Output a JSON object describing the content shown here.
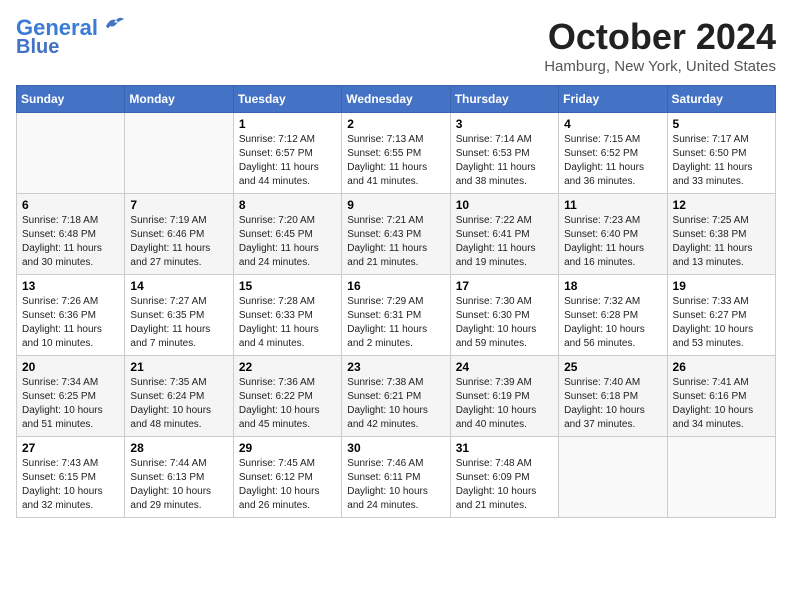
{
  "header": {
    "logo_line1": "General",
    "logo_line2": "Blue",
    "month": "October 2024",
    "location": "Hamburg, New York, United States"
  },
  "weekdays": [
    "Sunday",
    "Monday",
    "Tuesday",
    "Wednesday",
    "Thursday",
    "Friday",
    "Saturday"
  ],
  "weeks": [
    [
      {
        "day": null,
        "info": null
      },
      {
        "day": null,
        "info": null
      },
      {
        "day": "1",
        "info": "Sunrise: 7:12 AM\nSunset: 6:57 PM\nDaylight: 11 hours and 44 minutes."
      },
      {
        "day": "2",
        "info": "Sunrise: 7:13 AM\nSunset: 6:55 PM\nDaylight: 11 hours and 41 minutes."
      },
      {
        "day": "3",
        "info": "Sunrise: 7:14 AM\nSunset: 6:53 PM\nDaylight: 11 hours and 38 minutes."
      },
      {
        "day": "4",
        "info": "Sunrise: 7:15 AM\nSunset: 6:52 PM\nDaylight: 11 hours and 36 minutes."
      },
      {
        "day": "5",
        "info": "Sunrise: 7:17 AM\nSunset: 6:50 PM\nDaylight: 11 hours and 33 minutes."
      }
    ],
    [
      {
        "day": "6",
        "info": "Sunrise: 7:18 AM\nSunset: 6:48 PM\nDaylight: 11 hours and 30 minutes."
      },
      {
        "day": "7",
        "info": "Sunrise: 7:19 AM\nSunset: 6:46 PM\nDaylight: 11 hours and 27 minutes."
      },
      {
        "day": "8",
        "info": "Sunrise: 7:20 AM\nSunset: 6:45 PM\nDaylight: 11 hours and 24 minutes."
      },
      {
        "day": "9",
        "info": "Sunrise: 7:21 AM\nSunset: 6:43 PM\nDaylight: 11 hours and 21 minutes."
      },
      {
        "day": "10",
        "info": "Sunrise: 7:22 AM\nSunset: 6:41 PM\nDaylight: 11 hours and 19 minutes."
      },
      {
        "day": "11",
        "info": "Sunrise: 7:23 AM\nSunset: 6:40 PM\nDaylight: 11 hours and 16 minutes."
      },
      {
        "day": "12",
        "info": "Sunrise: 7:25 AM\nSunset: 6:38 PM\nDaylight: 11 hours and 13 minutes."
      }
    ],
    [
      {
        "day": "13",
        "info": "Sunrise: 7:26 AM\nSunset: 6:36 PM\nDaylight: 11 hours and 10 minutes."
      },
      {
        "day": "14",
        "info": "Sunrise: 7:27 AM\nSunset: 6:35 PM\nDaylight: 11 hours and 7 minutes."
      },
      {
        "day": "15",
        "info": "Sunrise: 7:28 AM\nSunset: 6:33 PM\nDaylight: 11 hours and 4 minutes."
      },
      {
        "day": "16",
        "info": "Sunrise: 7:29 AM\nSunset: 6:31 PM\nDaylight: 11 hours and 2 minutes."
      },
      {
        "day": "17",
        "info": "Sunrise: 7:30 AM\nSunset: 6:30 PM\nDaylight: 10 hours and 59 minutes."
      },
      {
        "day": "18",
        "info": "Sunrise: 7:32 AM\nSunset: 6:28 PM\nDaylight: 10 hours and 56 minutes."
      },
      {
        "day": "19",
        "info": "Sunrise: 7:33 AM\nSunset: 6:27 PM\nDaylight: 10 hours and 53 minutes."
      }
    ],
    [
      {
        "day": "20",
        "info": "Sunrise: 7:34 AM\nSunset: 6:25 PM\nDaylight: 10 hours and 51 minutes."
      },
      {
        "day": "21",
        "info": "Sunrise: 7:35 AM\nSunset: 6:24 PM\nDaylight: 10 hours and 48 minutes."
      },
      {
        "day": "22",
        "info": "Sunrise: 7:36 AM\nSunset: 6:22 PM\nDaylight: 10 hours and 45 minutes."
      },
      {
        "day": "23",
        "info": "Sunrise: 7:38 AM\nSunset: 6:21 PM\nDaylight: 10 hours and 42 minutes."
      },
      {
        "day": "24",
        "info": "Sunrise: 7:39 AM\nSunset: 6:19 PM\nDaylight: 10 hours and 40 minutes."
      },
      {
        "day": "25",
        "info": "Sunrise: 7:40 AM\nSunset: 6:18 PM\nDaylight: 10 hours and 37 minutes."
      },
      {
        "day": "26",
        "info": "Sunrise: 7:41 AM\nSunset: 6:16 PM\nDaylight: 10 hours and 34 minutes."
      }
    ],
    [
      {
        "day": "27",
        "info": "Sunrise: 7:43 AM\nSunset: 6:15 PM\nDaylight: 10 hours and 32 minutes."
      },
      {
        "day": "28",
        "info": "Sunrise: 7:44 AM\nSunset: 6:13 PM\nDaylight: 10 hours and 29 minutes."
      },
      {
        "day": "29",
        "info": "Sunrise: 7:45 AM\nSunset: 6:12 PM\nDaylight: 10 hours and 26 minutes."
      },
      {
        "day": "30",
        "info": "Sunrise: 7:46 AM\nSunset: 6:11 PM\nDaylight: 10 hours and 24 minutes."
      },
      {
        "day": "31",
        "info": "Sunrise: 7:48 AM\nSunset: 6:09 PM\nDaylight: 10 hours and 21 minutes."
      },
      {
        "day": null,
        "info": null
      },
      {
        "day": null,
        "info": null
      }
    ]
  ]
}
